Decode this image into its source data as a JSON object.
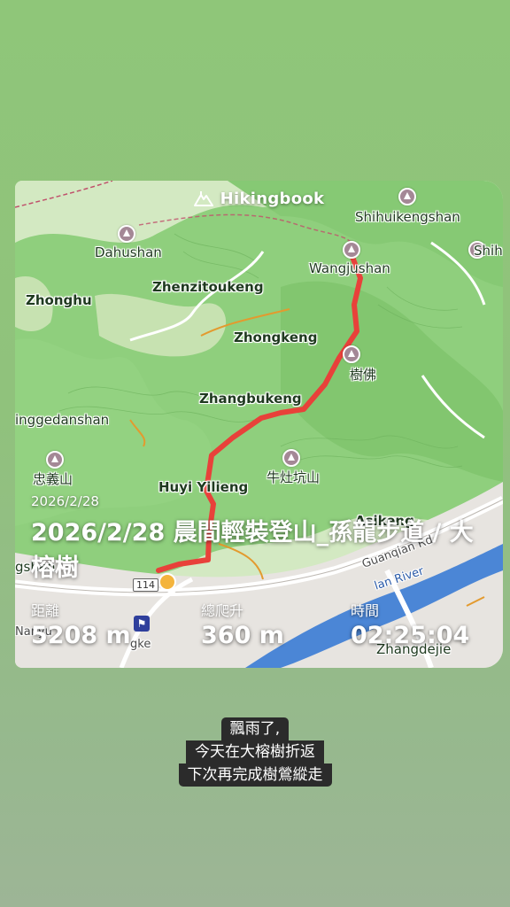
{
  "brand": {
    "name": "Hikingbook"
  },
  "map": {
    "places": [
      "Shihuikengshan",
      "Shihui",
      "Dahushan",
      "Wangjushan",
      "Zhenzitoukeng",
      "Zhonghu",
      "Zhongkeng",
      "樹佛",
      "Zhangbukeng",
      "inggedanshan",
      "忠義山",
      "牛灶坑山",
      "Huyi Yilieng",
      "Asikeng",
      "gshan",
      "Guanqian Rd",
      "lan River",
      "Zhangdejie",
      "Nanyu",
      "gke"
    ],
    "route_number": "114"
  },
  "activity": {
    "date": "2026/2/28",
    "title": "2026/2/28 晨間輕裝登山_孫龍步道 / 大榕樹",
    "stats": {
      "distance_label": "距離",
      "distance_value": "5208 m",
      "elevation_label": "總爬升",
      "elevation_value": "360 m",
      "time_label": "時間",
      "time_value": "02:25:04"
    }
  },
  "caption": {
    "line1": "飄雨了,",
    "line2": "今天在大榕樹折返",
    "line3": "下次再完成樹鶯縱走"
  },
  "colors": {
    "background": "#90c27c",
    "route": "#e8413a",
    "map_green": "#8fcf7d",
    "river": "#4b86d6"
  }
}
